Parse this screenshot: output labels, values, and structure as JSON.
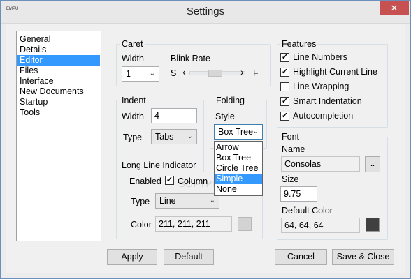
{
  "window": {
    "title": "Settings",
    "app_icon_text": "EMPU",
    "close_glyph": "✕"
  },
  "sidebar": {
    "items": [
      {
        "label": "General",
        "selected": false
      },
      {
        "label": "Details",
        "selected": false
      },
      {
        "label": "Editor",
        "selected": true
      },
      {
        "label": "Files",
        "selected": false
      },
      {
        "label": "Interface",
        "selected": false
      },
      {
        "label": "New Documents",
        "selected": false
      },
      {
        "label": "Startup",
        "selected": false
      },
      {
        "label": "Tools",
        "selected": false
      }
    ]
  },
  "caret": {
    "group_label": "Caret",
    "width_label": "Width",
    "width_value": "1",
    "blink_label": "Blink Rate",
    "slider_left_label": "S",
    "slider_right_label": "F",
    "left_arrow": "‹",
    "right_arrow": "›"
  },
  "indent": {
    "group_label": "Indent",
    "width_label": "Width",
    "width_value": "4",
    "type_label": "Type",
    "type_value": "Tabs"
  },
  "folding": {
    "group_label": "Folding",
    "style_label": "Style",
    "style_value": "Box Tree",
    "options": [
      {
        "label": "Arrow",
        "selected": false
      },
      {
        "label": "Box Tree",
        "selected": false
      },
      {
        "label": "Circle Tree",
        "selected": false
      },
      {
        "label": "Simple",
        "selected": true
      },
      {
        "label": "None",
        "selected": false
      }
    ]
  },
  "long_line": {
    "group_label": "Long Line Indicator",
    "enabled_label": "Enabled",
    "enabled_checked": true,
    "column_label": "Column",
    "type_label": "Type",
    "type_value": "Line",
    "color_label": "Color",
    "color_value": "211, 211, 211",
    "swatch_color": "#d3d3d3"
  },
  "features": {
    "group_label": "Features",
    "items": [
      {
        "label": "Line Numbers",
        "checked": true
      },
      {
        "label": "Highlight Current Line",
        "checked": true
      },
      {
        "label": "Line Wrapping",
        "checked": false
      },
      {
        "label": "Smart Indentation",
        "checked": true
      },
      {
        "label": "Autocompletion",
        "checked": true
      }
    ]
  },
  "font": {
    "group_label": "Font",
    "name_label": "Name",
    "name_value": "Consolas",
    "browse_label": "..",
    "size_label": "Size",
    "size_value": "9.75",
    "default_color_label": "Default Color",
    "default_color_value": "64, 64, 64",
    "swatch_color": "#404040"
  },
  "buttons": {
    "apply": "Apply",
    "default": "Default",
    "cancel": "Cancel",
    "save_close": "Save & Close"
  },
  "watermark": "SOFTPEDIA",
  "check_glyph": "✓",
  "combo_arrow": "⌄"
}
